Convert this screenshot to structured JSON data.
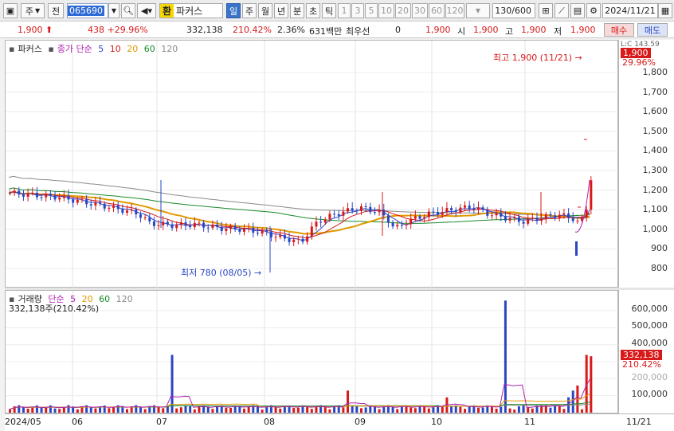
{
  "toolbar": {
    "type_label": "주",
    "all_label": "전",
    "code": "065690",
    "hwan": "환",
    "stock_name": "파커스",
    "periods": [
      "일",
      "주",
      "월",
      "년",
      "분",
      "초",
      "틱"
    ],
    "selected_period": "일",
    "minute_options": [
      "1",
      "3",
      "5",
      "10",
      "20",
      "30",
      "60",
      "120"
    ],
    "count": "130/600",
    "date": "2024/11/21"
  },
  "quote": {
    "price": "1,900",
    "change": "438 +29.96%",
    "volume": "332,138",
    "volume_ratio": "210.42%",
    "turnover": "2.36%",
    "amount": "631백만",
    "best_bid_label": "최우선",
    "best_bid_value": "0",
    "best_ask_value": "1,900",
    "open_label": "시",
    "open": "1,900",
    "high_label": "고",
    "high": "1,900",
    "low_label": "저",
    "low": "1,900",
    "buy_label": "매수",
    "sell_label": "매도"
  },
  "price_legend": {
    "name": "파커스",
    "type": "종가 단순",
    "ma": [
      {
        "label": "5",
        "color": "#3146c8"
      },
      {
        "label": "10",
        "color": "#d81919"
      },
      {
        "label": "20",
        "color": "#e09a00"
      },
      {
        "label": "60",
        "color": "#1a8a2a"
      },
      {
        "label": "120",
        "color": "#8a8a8a"
      }
    ]
  },
  "volume_legend": {
    "name": "거래량",
    "type": "단순",
    "ma": [
      {
        "label": "5",
        "color": "#b023b0"
      },
      {
        "label": "20",
        "color": "#e09a00"
      },
      {
        "label": "60",
        "color": "#1a8a2a"
      },
      {
        "label": "120",
        "color": "#8a8a8a"
      }
    ],
    "current": "332,138주(210.42%)"
  },
  "annotations": {
    "high": "최고 1,900 (11/21)",
    "low": "최저 780 (08/05)"
  },
  "price_axis": {
    "ticks": [
      "1,800",
      "1,700",
      "1,600",
      "1,500",
      "1,400",
      "1,300",
      "1,200",
      "1,100",
      "1,000",
      "900",
      "800"
    ],
    "top_tag": "1,900",
    "top_pct": "29.96%",
    "top_small": "L:C 143.59"
  },
  "volume_axis": {
    "ticks": [
      "600,000",
      "500,000",
      "400,000",
      "300,000",
      "200,000",
      "100,000"
    ],
    "tag_value": "332,138",
    "tag_pct": "210.42%"
  },
  "x_axis": {
    "labels": [
      "2024/05",
      "06",
      "07",
      "08",
      "09",
      "10",
      "11"
    ],
    "right_label": "11/21"
  },
  "chart_data": {
    "type": "candlestick",
    "title": "파커스",
    "y_range": [
      720,
      1880
    ],
    "volume_range": [
      0,
      680000
    ],
    "months": [
      "2024/05",
      "06",
      "07",
      "08",
      "09",
      "10",
      "11"
    ],
    "high_annotation": {
      "value": 1900,
      "date": "11/21"
    },
    "low_annotation": {
      "value": 780,
      "date": "08/05"
    },
    "last_close": 1900,
    "last_change_pct": 29.96,
    "last_volume": 332138
  },
  "colors": {
    "up": "#d81919",
    "down": "#2a46c4",
    "selected": "#3a74c9"
  }
}
